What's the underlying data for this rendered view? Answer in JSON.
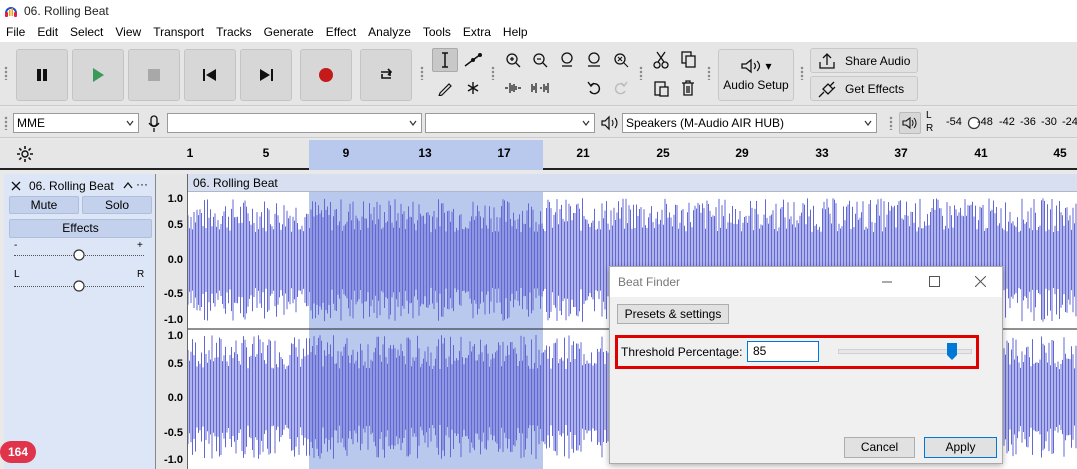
{
  "window": {
    "title": "06. Rolling Beat"
  },
  "menu": [
    "File",
    "Edit",
    "Select",
    "View",
    "Transport",
    "Tracks",
    "Generate",
    "Effect",
    "Analyze",
    "Tools",
    "Extra",
    "Help"
  ],
  "toolbar": {
    "audio_setup": "Audio Setup",
    "share_audio": "Share Audio",
    "get_effects": "Get Effects",
    "audio_setup_arrow": "▾"
  },
  "devices": {
    "host": "MME",
    "recording": "",
    "channels": "",
    "playback": "Speakers (M-Audio AIR HUB)"
  },
  "meter": {
    "l": "L",
    "r": "R",
    "ticks": [
      "-54",
      "-48",
      "-42",
      "-36",
      "-30",
      "-24"
    ]
  },
  "ruler": {
    "ticks": [
      "1",
      "5",
      "9",
      "13",
      "17",
      "21",
      "25",
      "29",
      "33",
      "37",
      "41",
      "45"
    ]
  },
  "track": {
    "name": "06. Rolling Beat",
    "mute": "Mute",
    "solo": "Solo",
    "effects": "Effects",
    "minus": "-",
    "plus": "+",
    "left": "L",
    "right": "R",
    "menu_dots": "···"
  },
  "scale": {
    "top": [
      "1.0",
      "0.5",
      "0.0",
      "-0.5",
      "-1.0"
    ],
    "bottom": [
      "1.0",
      "0.5",
      "0.0",
      "-0.5",
      "-1.0"
    ]
  },
  "clip": {
    "name": "06. Rolling Beat"
  },
  "dialog": {
    "title": "Beat Finder",
    "presets": "Presets & settings",
    "threshold_label": "Threshold Percentage:",
    "threshold_value": "85",
    "threshold_fraction": 0.85,
    "cancel": "Cancel",
    "apply": "Apply"
  },
  "badge": {
    "count": "164"
  },
  "colors": {
    "wave": "#6268d4",
    "selection": "#b9c9ee",
    "highlight": "#e00000"
  }
}
